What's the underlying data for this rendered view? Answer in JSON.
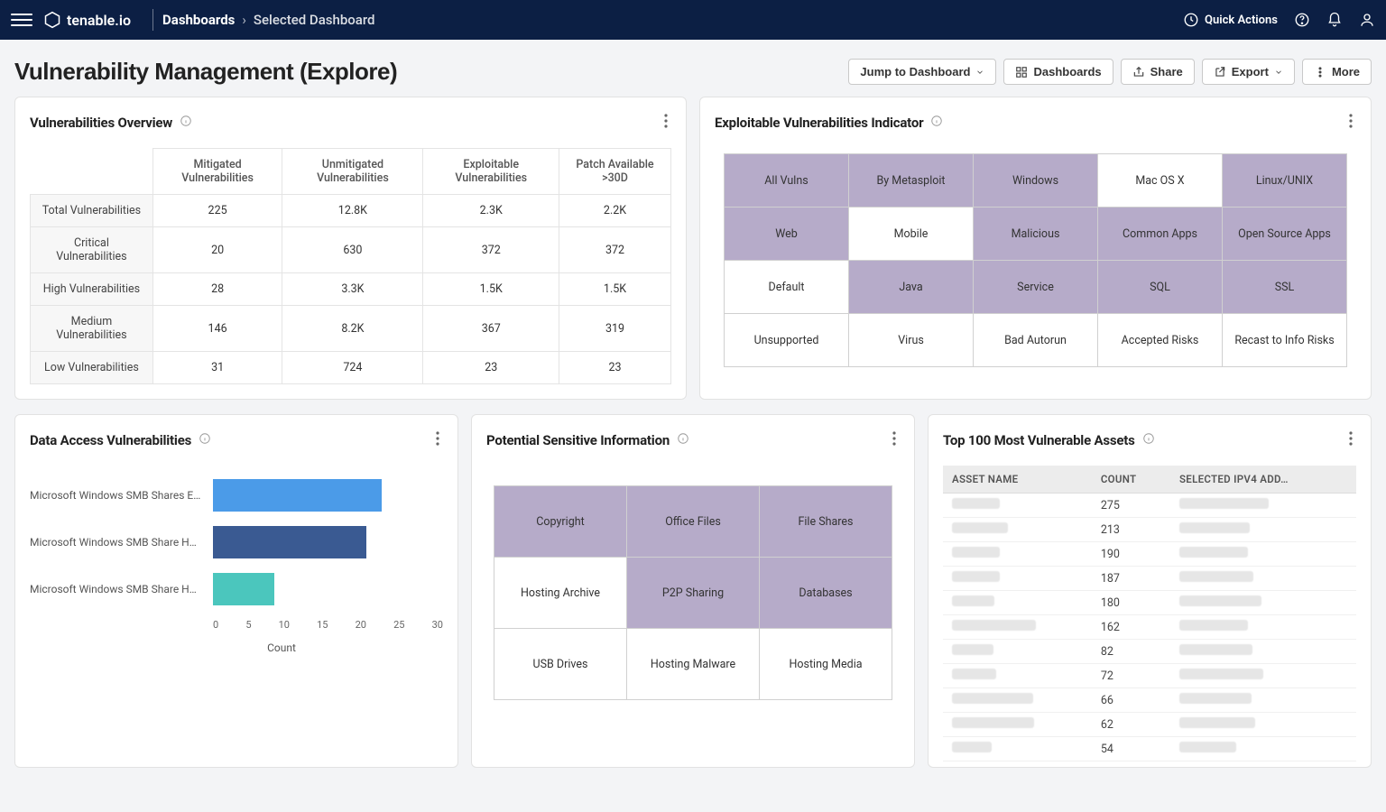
{
  "topbar": {
    "brand": "tenable.io",
    "crumb1": "Dashboards",
    "crumb2": "Selected Dashboard",
    "quick_actions": "Quick Actions"
  },
  "page": {
    "title": "Vulnerability Management (Explore)",
    "actions": {
      "jump": "Jump to Dashboard",
      "dashboards": "Dashboards",
      "share": "Share",
      "export": "Export",
      "more": "More"
    }
  },
  "cards": {
    "overview": {
      "title": "Vulnerabilities Overview"
    },
    "exploitable": {
      "title": "Exploitable Vulnerabilities Indicator"
    },
    "data_access": {
      "title": "Data Access Vulnerabilities"
    },
    "sensitive": {
      "title": "Potential Sensitive Information"
    },
    "top_assets": {
      "title": "Top 100 Most Vulnerable Assets"
    }
  },
  "overview_table": {
    "cols": [
      "Mitigated Vulnerabilities",
      "Unmitigated Vulnerabilities",
      "Exploitable Vulnerabilities",
      "Patch Available >30D"
    ],
    "rows": [
      {
        "label": "Total Vulnerabilities",
        "cells": [
          "225",
          "12.8K",
          "2.3K",
          "2.2K"
        ]
      },
      {
        "label": "Critical Vulnerabilities",
        "cells": [
          "20",
          "630",
          "372",
          "372"
        ]
      },
      {
        "label": "High Vulnerabilities",
        "cells": [
          "28",
          "3.3K",
          "1.5K",
          "1.5K"
        ]
      },
      {
        "label": "Medium Vulnerabilities",
        "cells": [
          "146",
          "8.2K",
          "367",
          "319"
        ]
      },
      {
        "label": "Low Vulnerabilities",
        "cells": [
          "31",
          "724",
          "23",
          "23"
        ]
      }
    ]
  },
  "exploitable_tiles": [
    {
      "label": "All Vulns",
      "on": true
    },
    {
      "label": "By Metasploit",
      "on": true
    },
    {
      "label": "Windows",
      "on": true
    },
    {
      "label": "Mac OS X",
      "on": false
    },
    {
      "label": "Linux/UNIX",
      "on": true
    },
    {
      "label": "Web",
      "on": true
    },
    {
      "label": "Mobile",
      "on": false
    },
    {
      "label": "Malicious",
      "on": true
    },
    {
      "label": "Common Apps",
      "on": true
    },
    {
      "label": "Open Source Apps",
      "on": true
    },
    {
      "label": "Default",
      "on": false
    },
    {
      "label": "Java",
      "on": true
    },
    {
      "label": "Service",
      "on": true
    },
    {
      "label": "SQL",
      "on": true
    },
    {
      "label": "SSL",
      "on": true
    },
    {
      "label": "Unsupported",
      "on": false
    },
    {
      "label": "Virus",
      "on": false
    },
    {
      "label": "Bad Autorun",
      "on": false
    },
    {
      "label": "Accepted Risks",
      "on": false
    },
    {
      "label": "Recast to Info Risks",
      "on": false
    }
  ],
  "sensitive_tiles": [
    {
      "label": "Copyright",
      "on": true
    },
    {
      "label": "Office Files",
      "on": true
    },
    {
      "label": "File Shares",
      "on": true
    },
    {
      "label": "Hosting Archive",
      "on": false
    },
    {
      "label": "P2P Sharing",
      "on": true
    },
    {
      "label": "Databases",
      "on": true
    },
    {
      "label": "USB Drives",
      "on": false
    },
    {
      "label": "Hosting Malware",
      "on": false
    },
    {
      "label": "Hosting Media",
      "on": false
    }
  ],
  "chart_data": {
    "type": "bar",
    "title": "Data Access Vulnerabilities",
    "xlabel": "Count",
    "ylabel": "",
    "xlim": [
      0,
      30
    ],
    "ticks": [
      0,
      5,
      10,
      15,
      20,
      25,
      30
    ],
    "series": [
      {
        "name": "Microsoft Windows SMB Shares En…",
        "value": 22,
        "color": "#4b9be8"
      },
      {
        "name": "Microsoft Windows SMB Share Ho…",
        "value": 20,
        "color": "#3a5a92"
      },
      {
        "name": "Microsoft Windows SMB Share Ho…",
        "value": 8,
        "color": "#4bc6bd"
      }
    ]
  },
  "assets_table": {
    "cols": [
      "ASSET NAME",
      "COUNT",
      "SELECTED IPV4 ADD…"
    ],
    "rows": [
      {
        "count": "275"
      },
      {
        "count": "213"
      },
      {
        "count": "190"
      },
      {
        "count": "187"
      },
      {
        "count": "180"
      },
      {
        "count": "162"
      },
      {
        "count": "82"
      },
      {
        "count": "72"
      },
      {
        "count": "66"
      },
      {
        "count": "62"
      },
      {
        "count": "54"
      }
    ]
  }
}
